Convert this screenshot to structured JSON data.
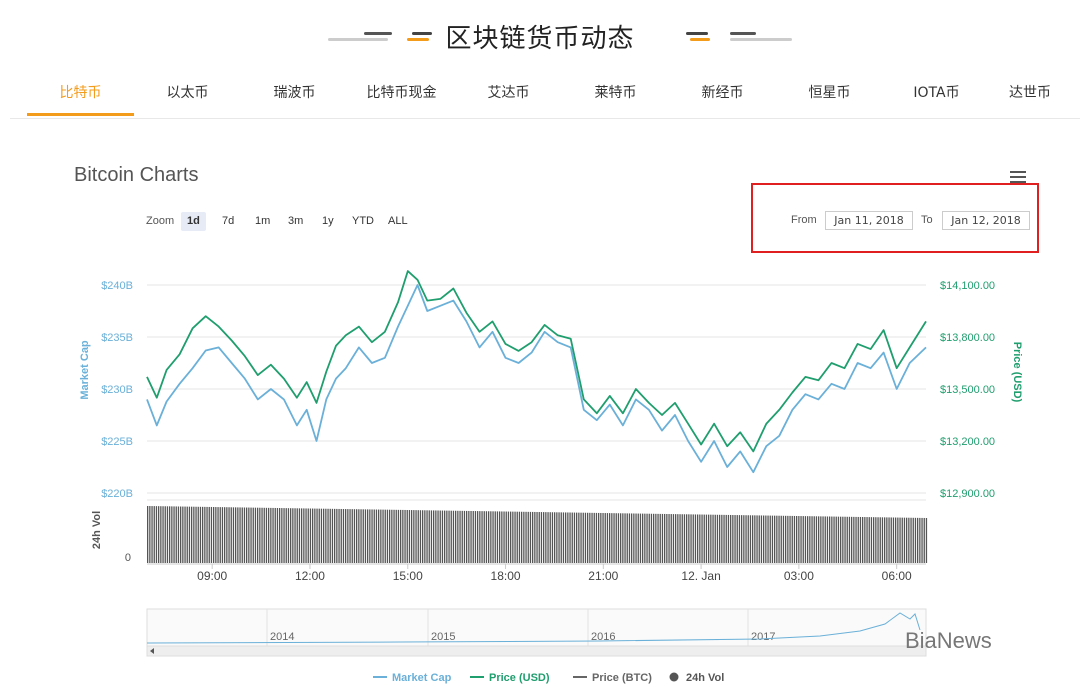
{
  "header": {
    "title": "区块链货币动态"
  },
  "tabs": [
    {
      "label": "比特币",
      "active": true
    },
    {
      "label": "以太币",
      "active": false
    },
    {
      "label": "瑞波币",
      "active": false
    },
    {
      "label": "比特币现金",
      "active": false
    },
    {
      "label": "艾达币",
      "active": false
    },
    {
      "label": "莱特币",
      "active": false
    },
    {
      "label": "新经币",
      "active": false
    },
    {
      "label": "恒星币",
      "active": false
    },
    {
      "label": "IOTA币",
      "active": false
    },
    {
      "label": "达世币",
      "active": false
    }
  ],
  "zoom": {
    "label": "Zoom",
    "options": [
      "1d",
      "7d",
      "1m",
      "3m",
      "1y",
      "YTD",
      "ALL"
    ],
    "selected": "1d"
  },
  "range": {
    "from_label": "From",
    "from_value": "Jan 11, 2018",
    "to_label": "To",
    "to_value": "Jan 12, 2018"
  },
  "watermark": "BiaNews",
  "colors": {
    "accent": "#f39b1b",
    "market_cap": "#6ab0d8",
    "price_usd": "#1f9e6e",
    "price_btc": "#666666",
    "volume": "#555555",
    "highlight": "#e02020"
  },
  "chart_data": {
    "type": "line",
    "title": "Bitcoin Charts",
    "left_axis": {
      "label": "Market Cap",
      "ticks": [
        "$220B",
        "$225B",
        "$230B",
        "$235B",
        "$240B"
      ],
      "range": [
        220,
        240
      ]
    },
    "right_axis": {
      "label": "Price (USD)",
      "ticks": [
        "$12,900.00",
        "$13,200.00",
        "$13,500.00",
        "$13,800.00",
        "$14,100.00"
      ],
      "range": [
        12900,
        14100
      ]
    },
    "volume_axis": {
      "label": "24h Vol",
      "ticks": [
        "0"
      ]
    },
    "x_ticks": [
      "09:00",
      "12:00",
      "15:00",
      "18:00",
      "21:00",
      "12. Jan",
      "03:00",
      "06:00"
    ],
    "x_range": [
      7.0,
      30.9
    ],
    "series": [
      {
        "name": "Market Cap",
        "axis": "left",
        "x": [
          7.0,
          7.3,
          7.6,
          8.0,
          8.4,
          8.8,
          9.2,
          9.6,
          10.0,
          10.4,
          10.8,
          11.2,
          11.6,
          11.9,
          12.2,
          12.5,
          12.8,
          13.1,
          13.5,
          13.9,
          14.3,
          14.7,
          15.0,
          15.3,
          15.6,
          16.0,
          16.4,
          16.8,
          17.2,
          17.6,
          18.0,
          18.4,
          18.8,
          19.2,
          19.6,
          20.0,
          20.4,
          20.8,
          21.2,
          21.6,
          22.0,
          22.4,
          22.8,
          23.2,
          23.6,
          24.0,
          24.4,
          24.8,
          25.2,
          25.6,
          26.0,
          26.4,
          26.8,
          27.2,
          27.6,
          28.0,
          28.4,
          28.8,
          29.2,
          29.6,
          30.0,
          30.4,
          30.9
        ],
        "values": [
          229.0,
          226.5,
          228.8,
          230.5,
          232.0,
          233.7,
          234.0,
          232.5,
          231.0,
          229.0,
          230.0,
          229.0,
          226.5,
          228.0,
          225.0,
          229.0,
          231.0,
          232.0,
          234.0,
          232.5,
          233.0,
          236.0,
          238.0,
          240.0,
          237.5,
          238.0,
          238.5,
          236.5,
          234.0,
          235.5,
          233.0,
          232.5,
          233.5,
          235.5,
          234.5,
          234.0,
          228.0,
          227.0,
          228.5,
          226.5,
          229.0,
          228.0,
          226.0,
          227.5,
          225.0,
          223.0,
          225.0,
          222.5,
          224.0,
          222.0,
          224.5,
          225.5,
          228.0,
          229.5,
          229.0,
          230.5,
          230.0,
          232.5,
          232.0,
          233.5,
          230.0,
          232.5,
          234.0
        ]
      },
      {
        "name": "Price (USD)",
        "axis": "right",
        "x": [
          7.0,
          7.3,
          7.6,
          8.0,
          8.4,
          8.8,
          9.2,
          9.6,
          10.0,
          10.4,
          10.8,
          11.2,
          11.6,
          11.9,
          12.2,
          12.5,
          12.8,
          13.1,
          13.5,
          13.9,
          14.3,
          14.7,
          15.0,
          15.3,
          15.6,
          16.0,
          16.4,
          16.8,
          17.2,
          17.6,
          18.0,
          18.4,
          18.8,
          19.2,
          19.6,
          20.0,
          20.4,
          20.8,
          21.2,
          21.6,
          22.0,
          22.4,
          22.8,
          23.2,
          23.6,
          24.0,
          24.4,
          24.8,
          25.2,
          25.6,
          26.0,
          26.4,
          26.8,
          27.2,
          27.6,
          28.0,
          28.4,
          28.8,
          29.2,
          29.6,
          30.0,
          30.4,
          30.9
        ],
        "values": [
          13570,
          13450,
          13610,
          13700,
          13850,
          13920,
          13860,
          13780,
          13690,
          13580,
          13640,
          13560,
          13450,
          13540,
          13420,
          13600,
          13750,
          13810,
          13860,
          13770,
          13830,
          14000,
          14180,
          14130,
          14010,
          14020,
          14080,
          13940,
          13830,
          13890,
          13760,
          13720,
          13770,
          13870,
          13810,
          13790,
          13440,
          13360,
          13460,
          13360,
          13500,
          13420,
          13350,
          13420,
          13300,
          13180,
          13300,
          13170,
          13250,
          13140,
          13300,
          13380,
          13480,
          13570,
          13550,
          13650,
          13620,
          13760,
          13730,
          13840,
          13620,
          13740,
          13890
        ]
      }
    ],
    "legend": {
      "position": "bottom-center",
      "entries": [
        "Market Cap",
        "Price (USD)",
        "Price (BTC)",
        "24h Vol"
      ]
    },
    "navigator": {
      "x_ticks": [
        "2014",
        "2015",
        "2016",
        "2017"
      ]
    },
    "grid": true
  }
}
